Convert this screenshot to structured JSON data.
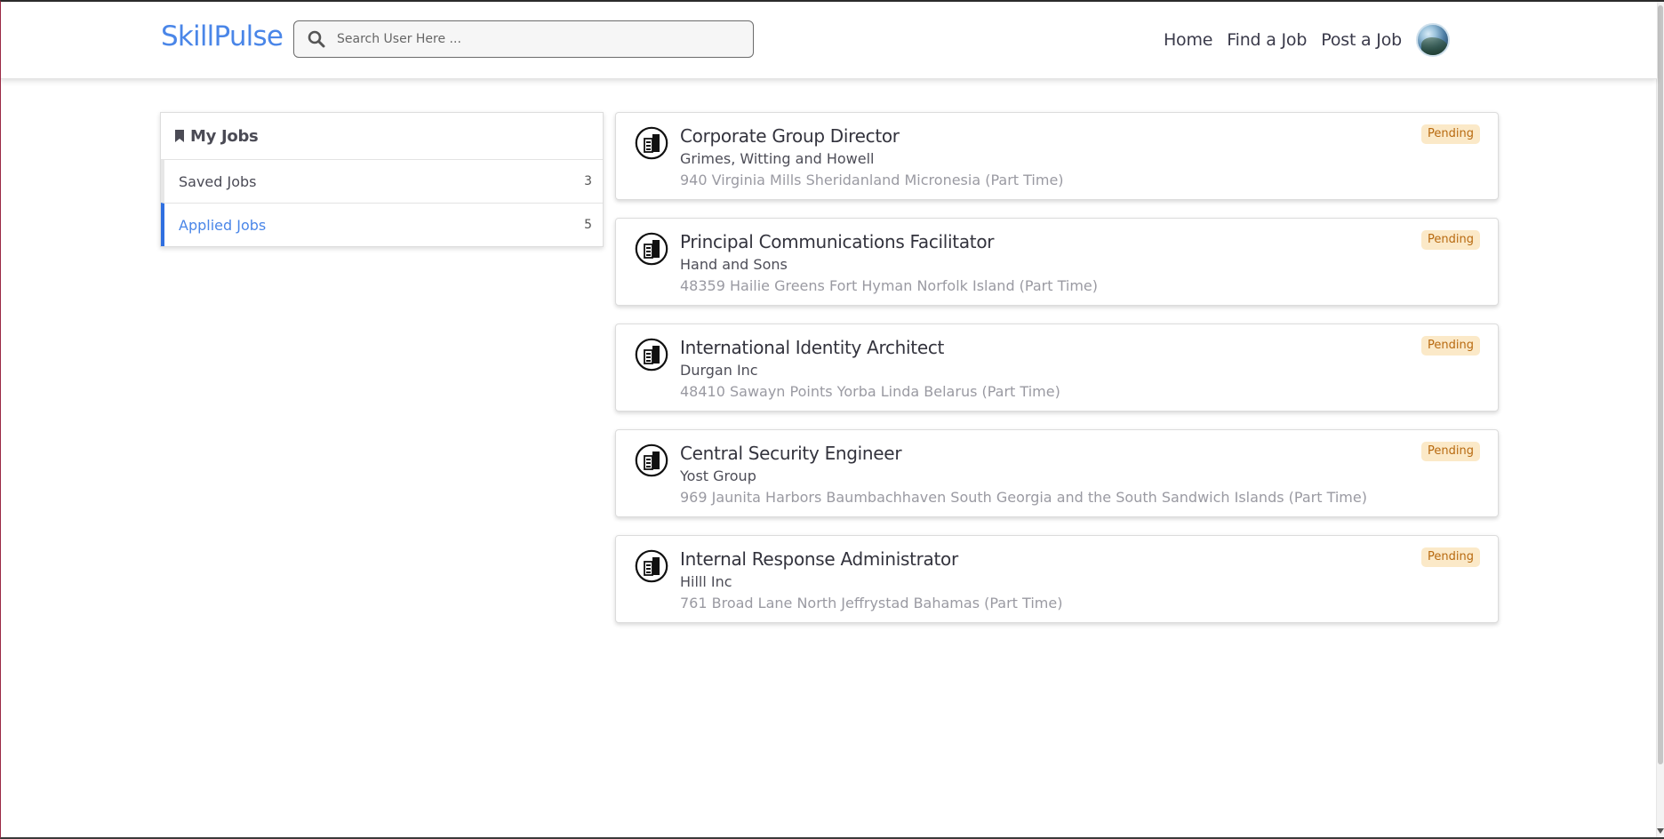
{
  "brand": {
    "name": "SkillPulse",
    "color": "#4a86e8"
  },
  "search": {
    "placeholder": "Search User Here ..."
  },
  "nav": {
    "links": [
      "Home",
      "Find a Job",
      "Post a Job"
    ]
  },
  "sidebar": {
    "title": "My Jobs",
    "items": [
      {
        "label": "Saved Jobs",
        "count": "3",
        "active": false
      },
      {
        "label": "Applied Jobs",
        "count": "5",
        "active": true
      }
    ]
  },
  "jobs": [
    {
      "title": "Corporate Group Director",
      "company": "Grimes, Witting and Howell",
      "location": "940 Virginia Mills Sheridanland Micronesia (Part Time)",
      "status": "Pending"
    },
    {
      "title": "Principal Communications Facilitator",
      "company": "Hand and Sons",
      "location": "48359 Hailie Greens Fort Hyman Norfolk Island (Part Time)",
      "status": "Pending"
    },
    {
      "title": "International Identity Architect",
      "company": "Durgan Inc",
      "location": "48410 Sawayn Points Yorba Linda Belarus (Part Time)",
      "status": "Pending"
    },
    {
      "title": "Central Security Engineer",
      "company": "Yost Group",
      "location": "969 Jaunita Harbors Baumbachhaven South Georgia and the South Sandwich Islands (Part Time)",
      "status": "Pending"
    },
    {
      "title": "Internal Response Administrator",
      "company": "Hilll Inc",
      "location": "761 Broad Lane North Jeffrystad Bahamas (Part Time)",
      "status": "Pending"
    }
  ],
  "colors": {
    "accent": "#4a86e8",
    "active_border": "#2f6fe0",
    "badge_bg": "#fbe9c8",
    "badge_text": "#b86a10"
  },
  "icons": {
    "search": "search-icon",
    "bookmark": "bookmark-icon",
    "company": "building-icon",
    "avatar": "avatar"
  }
}
